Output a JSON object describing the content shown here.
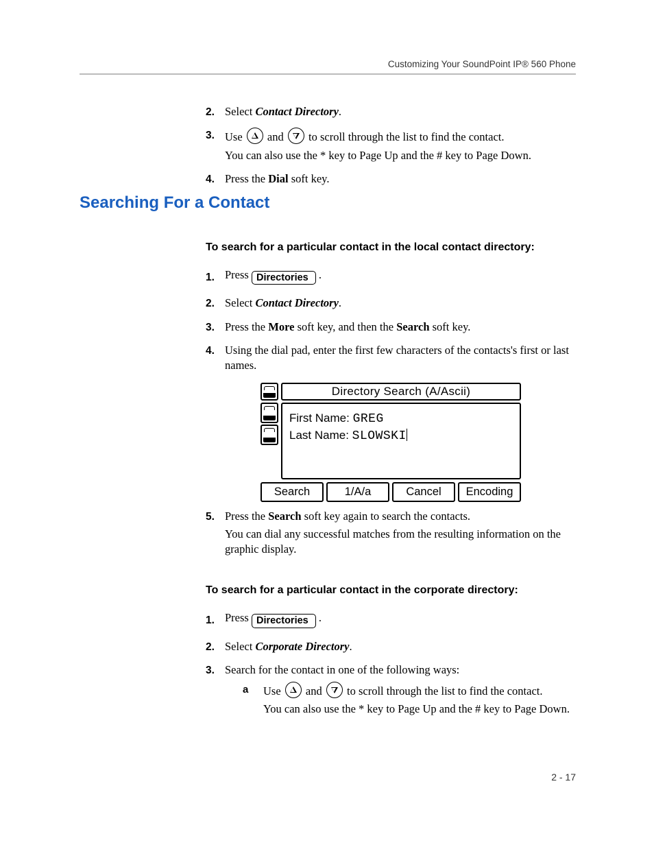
{
  "header": {
    "running_title": "Customizing Your SoundPoint IP® 560 Phone"
  },
  "top_steps": {
    "step2": {
      "num": "2.",
      "text_pre": "Select ",
      "bold_italic": "Contact Directory",
      "text_post": "."
    },
    "step3": {
      "num": "3.",
      "line1_pre": "Use ",
      "line1_mid": " and ",
      "line1_post": " to scroll through the list to find the contact.",
      "line2": "You can also use the * key to Page Up and the # key to Page Down."
    },
    "step4": {
      "num": "4.",
      "pre": "Press the ",
      "bold": "Dial",
      "post": " soft key."
    }
  },
  "section_heading": "Searching For a Contact",
  "local": {
    "heading": "To search for a particular contact in the local contact directory:",
    "s1": {
      "num": "1.",
      "pre": "Press ",
      "btn": "Directories",
      "post": " ."
    },
    "s2": {
      "num": "2.",
      "pre": "Select ",
      "bi": "Contact Directory",
      "post": "."
    },
    "s3": {
      "num": "3.",
      "pre": "Press the ",
      "b1": "More",
      "mid": " soft key, and then the ",
      "b2": "Search",
      "post": " soft key."
    },
    "s4": {
      "num": "4.",
      "text": "Using the dial pad, enter the first few characters of the contacts's first or last names."
    },
    "s5": {
      "num": "5.",
      "line1_pre": "Press the ",
      "line1_b": "Search",
      "line1_post": " soft key again to search the contacts.",
      "line2": "You can dial any successful matches from the resulting information on the graphic display."
    }
  },
  "lcd": {
    "title": "Directory Search (A/Ascii)",
    "fn_label": "First Name:",
    "fn_value": "GREG",
    "ln_label": "Last Name:",
    "ln_value": "SLOWSKI",
    "soft": [
      "Search",
      "1/A/a",
      "Cancel",
      "Encoding"
    ]
  },
  "corp": {
    "heading": "To search for a particular contact in the corporate directory:",
    "s1": {
      "num": "1.",
      "pre": "Press ",
      "btn": "Directories",
      "post": " ."
    },
    "s2": {
      "num": "2.",
      "pre": "Select ",
      "bi": "Corporate Directory",
      "post": "."
    },
    "s3": {
      "num": "3.",
      "text": "Search for the contact in one of the following ways:"
    },
    "sa": {
      "letter": "a",
      "line1_pre": "Use ",
      "line1_mid": " and ",
      "line1_post": " to scroll through the list to find the contact.",
      "line2": "You can also use the * key to Page Up and the # key to Page Down."
    }
  },
  "footer": {
    "page": "2 - 17"
  }
}
